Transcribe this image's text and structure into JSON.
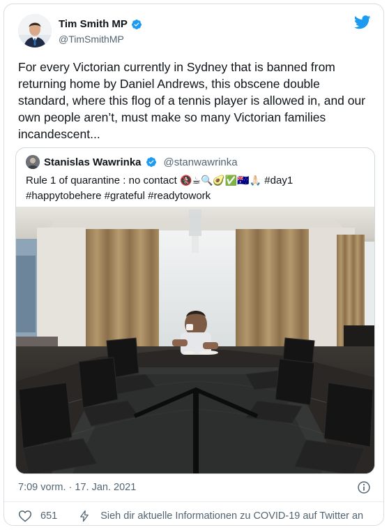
{
  "author": {
    "name": "Tim Smith MP",
    "handle": "@TimSmithMP",
    "verified": true
  },
  "tweet": {
    "text": "For every Victorian currently in Sydney that is banned from returning home by Daniel Andrews, this obscene double standard, where this flog of a tennis player is allowed in, and our own people aren’t, must make so many Victorian families incandescent..."
  },
  "quoted": {
    "name": "Stanislas Wawrinka",
    "handle": "@stanwawrinka",
    "verified": true,
    "text_prefix": "Rule 1 of quarantine : no contact ",
    "emojis": "🚷☕🔍🥑✅🇦🇺🙏🏻",
    "hashtags": " #day1 #happytobehere #grateful #readytowork"
  },
  "meta": {
    "timestamp": "7:09 vorm. · 17. Jan. 2021"
  },
  "actions": {
    "like_count": "651",
    "covid_link": "Sieh dir aktuelle Informationen zu COVID-19 auf Twitter an"
  },
  "colors": {
    "brand_blue": "#1d9bf0",
    "text_primary": "#0f1419",
    "text_secondary": "#536471",
    "border": "#cfd9de"
  },
  "icons": [
    "verified-badge-icon",
    "twitter-logo-icon",
    "info-icon",
    "heart-icon",
    "lightning-icon"
  ]
}
